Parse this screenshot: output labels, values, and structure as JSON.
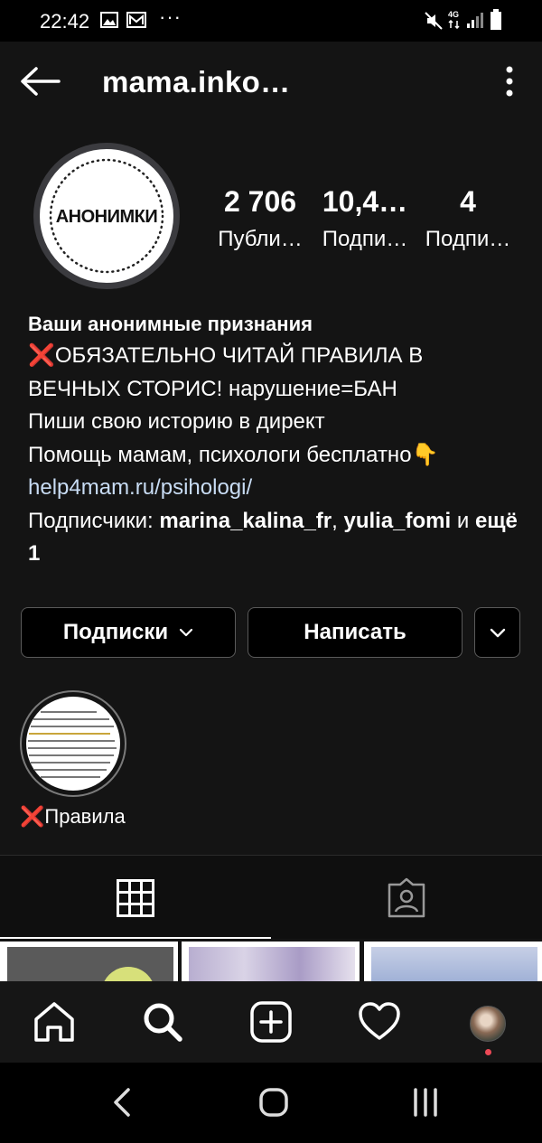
{
  "status_bar": {
    "time": "22:42",
    "dots": "···",
    "network": "4G",
    "icons": [
      "image-icon",
      "mail-icon",
      "mute-icon",
      "signal-icon",
      "battery-icon"
    ]
  },
  "header": {
    "title": "mama.inko…",
    "back_icon": "arrow-left-icon",
    "menu_icon": "more-vertical-icon"
  },
  "profile": {
    "avatar_text": "АНОНИМКИ",
    "stats": [
      {
        "value": "2 706",
        "label": "Публи…"
      },
      {
        "value": "10,4…",
        "label": "Подпи…"
      },
      {
        "value": "4",
        "label": "Подпи…"
      }
    ]
  },
  "bio": {
    "name": "Ваши анонимные признания",
    "line1": "❌ОБЯЗАТЕЛЬНО ЧИТАЙ ПРАВИЛА В ВЕЧНЫХ СТОРИС! нарушение=БАН",
    "line2": "Пиши свою историю в директ",
    "line3": "Помощь мамам, психологи бесплатно👇",
    "link": "help4mam.ru/psihologi/",
    "followers_prefix": "Подписчики: ",
    "follower1": "marina_kalina_fr",
    "comma": ", ",
    "follower2": "yulia_fomi",
    "and": " и ",
    "more": "ещё 1"
  },
  "actions": {
    "following_label": "Подписки",
    "message_label": "Написать"
  },
  "highlight": {
    "label": "❌Правила"
  },
  "tabs": [
    "grid-icon",
    "tagged-icon"
  ],
  "bottom_nav": [
    "home-icon",
    "search-icon",
    "add-post-icon",
    "heart-icon",
    "profile-avatar"
  ],
  "colors": {
    "background": "#141414",
    "link": "#c8dcf4",
    "notification_dot": "#ed4956"
  }
}
